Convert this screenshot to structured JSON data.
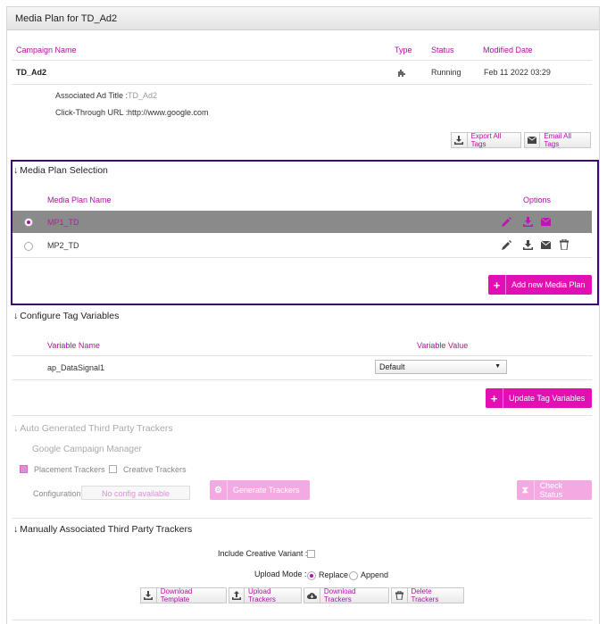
{
  "header": {
    "title": "Media Plan for TD_Ad2"
  },
  "campaign": {
    "columns": [
      "Campaign Name",
      "Type",
      "Status",
      "Modified Date"
    ],
    "name": "TD_Ad2",
    "status": "Running",
    "modified": "Feb 11 2022 03:29",
    "ad_title_label": "Associated Ad Title :",
    "ad_title_value": "TD_Ad2",
    "click_label": "Click-Through URL :",
    "click_value": "http://www.google.com",
    "export_all": "Export All Tags",
    "email_all": "Email All Tags"
  },
  "media_plan": {
    "section_title": "Media Plan Selection",
    "col_name": "Media Plan Name",
    "col_options": "Options",
    "rows": [
      {
        "name": "MP1_TD",
        "selected": true
      },
      {
        "name": "MP2_TD",
        "selected": false
      }
    ],
    "add_button": "Add new Media Plan"
  },
  "tag_vars": {
    "section_title": "Configure Tag Variables",
    "col_name": "Variable Name",
    "col_value": "Variable Value",
    "var_name": "ap_DataSignal1",
    "var_value": "Default",
    "update_button": "Update Tag Variables"
  },
  "auto_trackers": {
    "section_title": "Auto Generated Third Party Trackers",
    "subtitle": "Google Campaign Manager",
    "placement_label": "Placement Trackers",
    "creative_label": "Creative Trackers",
    "config_label": "Configuration",
    "config_placeholder": "No config available",
    "generate_button": "Generate Trackers",
    "check_button": "Check Status"
  },
  "manual_trackers": {
    "section_title": "Manually Associated Third Party Trackers",
    "include_label": "Include Creative Variant :",
    "upload_mode_label": "Upload Mode :",
    "replace_label": "Replace",
    "append_label": "Append",
    "download_template": "Download Template",
    "upload_trackers": "Upload Trackers",
    "download_trackers": "Download Trackers",
    "delete_trackers": "Delete Trackers"
  }
}
